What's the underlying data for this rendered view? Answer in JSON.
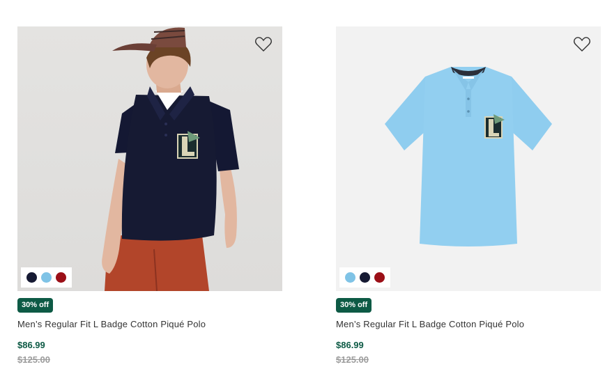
{
  "products": [
    {
      "discount_badge": "30% off",
      "name": "Men’s Regular Fit L Badge Cotton Piqué Polo",
      "price": "$86.99",
      "original_price": "$125.00",
      "image": "model-wearing-navy-polo",
      "swatches": [
        {
          "name": "navy",
          "color": "#161a33"
        },
        {
          "name": "light-blue",
          "color": "#7fc3e6"
        },
        {
          "name": "red",
          "color": "#9b0f17"
        }
      ]
    },
    {
      "discount_badge": "30% off",
      "name": "Men’s Regular Fit L Badge Cotton Piqué Polo",
      "price": "$86.99",
      "original_price": "$125.00",
      "image": "light-blue-polo-flat",
      "swatches": [
        {
          "name": "light-blue",
          "color": "#7fc3e6"
        },
        {
          "name": "navy",
          "color": "#161a33"
        },
        {
          "name": "red",
          "color": "#9b0f17"
        }
      ]
    }
  ],
  "colors": {
    "badge_bg": "#0d5a45",
    "price": "#0d5a45",
    "old_price": "#9c9c9c"
  }
}
